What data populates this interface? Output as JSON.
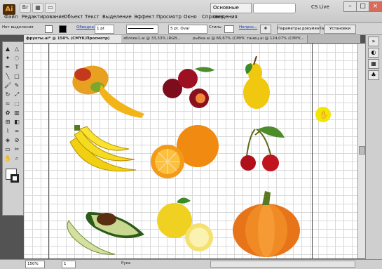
{
  "app": {
    "logo": "Ai",
    "workspace": "Основные сведения",
    "cs_live": "CS Live"
  },
  "menu": [
    "Файл",
    "Редактирование",
    "Объект",
    "Текст",
    "Выделение",
    "Эффект",
    "Просмотр",
    "Окно",
    "Справка"
  ],
  "control": {
    "selection": "Нет выделения",
    "stroke_label": "Обводка:",
    "stroke_value": "1 pt",
    "brush": "5 pt. Oval",
    "style_label": "Стиль:",
    "opacity_label": "Непроз...",
    "doc_setup": "Параметры документа",
    "prefs": "Установки"
  },
  "tabs": [
    "фрукты.ai* @ 150% (CMYK/Просмотр)",
    "яблоки1.ai @ 33,33% (RGB...",
    "рыбка.ai @ 66,67% (CMYK...",
    "танец.ai @ 124,07% (CMYK..."
  ],
  "status": {
    "zoom": "150%",
    "page": "1",
    "tool": "Рука"
  },
  "colors": {
    "accent_cursor": "#f2e600",
    "fill_swatch": "#ffffff"
  },
  "icons": [
    "selection-tool",
    "direct-selection-tool",
    "magic-wand-tool",
    "lasso-tool",
    "pen-tool",
    "type-tool",
    "line-tool",
    "rectangle-tool",
    "paintbrush-tool",
    "pencil-tool",
    "rotate-tool",
    "scale-tool",
    "warp-tool",
    "free-transform-tool",
    "symbol-sprayer-tool",
    "graph-tool",
    "mesh-tool",
    "gradient-tool",
    "eyedropper-tool",
    "blend-tool",
    "live-paint-tool",
    "slice-tool",
    "eraser-tool",
    "scissors-tool",
    "hand-tool",
    "zoom-tool"
  ]
}
